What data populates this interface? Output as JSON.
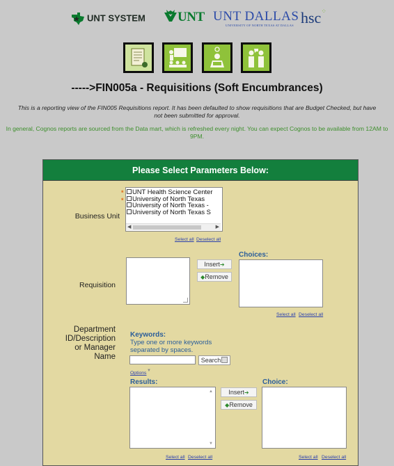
{
  "logos": {
    "system": "UNT SYSTEM",
    "unt": "UNT",
    "dallas": "UNT DALLAS",
    "dallas_sub": "UNIVERSITY OF NORTH TEXAS AT DALLAS",
    "hsc": "hsc"
  },
  "tiles": [
    "report-doc-icon",
    "presenter-icon",
    "learner-icon",
    "people-icon"
  ],
  "page": {
    "title": "----->FIN005a - Requisitions (Soft Encumbrances)",
    "description": "This is a reporting view of the FIN005 Requisitions report. It has been defaulted to show requisitions that are Budget Checked, but have not been submitted for approval.",
    "note": "In general, Cognos reports are sourced from the Data mart, which is refreshed every night. You can expect Cognos to be available from 12AM to 9PM."
  },
  "panel": {
    "header": "Please Select Parameters Below:",
    "business_unit": {
      "label": "Business Unit",
      "items": [
        "UNT Health Science Center",
        "University of North Texas",
        "University of North Texas -",
        "University of North Texas S"
      ],
      "select_all": "Select all",
      "deselect_all": "Deselect all"
    },
    "requisition": {
      "label": "Requisition",
      "insert": "Insert",
      "remove": "Remove",
      "choices_label": "Choices:",
      "select_all": "Select all",
      "deselect_all": "Deselect all"
    },
    "department": {
      "label_lines": [
        "Department",
        "ID/Description",
        "or Manager",
        "Name"
      ],
      "keywords_label": "Keywords:",
      "keywords_help_lines": [
        "Type one or more keywords",
        "separated by spaces."
      ],
      "search_value": "",
      "search_button": "Search",
      "options": "Options",
      "results_label": "Results:",
      "choice_label": "Choice:",
      "insert": "Insert",
      "remove": "Remove",
      "results_select_all": "Select all",
      "results_deselect_all": "Deselect all",
      "choice_select_all": "Select all",
      "choice_deselect_all": "Deselect all"
    }
  },
  "colors": {
    "page_bg": "#c9c9c9",
    "panel_bg": "#e3d9a2",
    "header_green": "#137f3d",
    "note_green": "#3d8f2c",
    "label_blue": "#2a5d9a",
    "required_orange": "#e26a1a"
  }
}
